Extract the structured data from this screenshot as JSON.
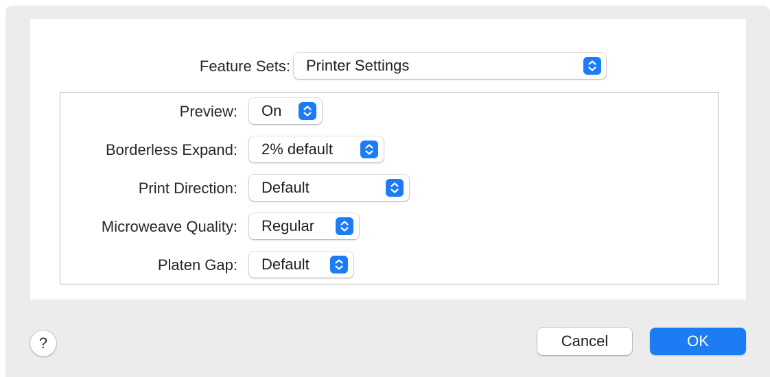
{
  "feature_sets": {
    "label": "Feature Sets:",
    "value": "Printer Settings"
  },
  "settings": {
    "preview": {
      "label": "Preview:",
      "value": "On"
    },
    "borderless_expand": {
      "label": "Borderless Expand:",
      "value": "2% default"
    },
    "print_direction": {
      "label": "Print Direction:",
      "value": "Default"
    },
    "microweave_quality": {
      "label": "Microweave Quality:",
      "value": "Regular"
    },
    "platen_gap": {
      "label": "Platen Gap:",
      "value": "Default"
    }
  },
  "footer": {
    "help_label": "?",
    "cancel_label": "Cancel",
    "ok_label": "OK"
  },
  "colors": {
    "accent": "#1b7cf5",
    "dialog_background": "#ececec",
    "panel_background": "#ffffff"
  },
  "icons": {
    "popup_arrows": "up-down-chevron-icon"
  }
}
